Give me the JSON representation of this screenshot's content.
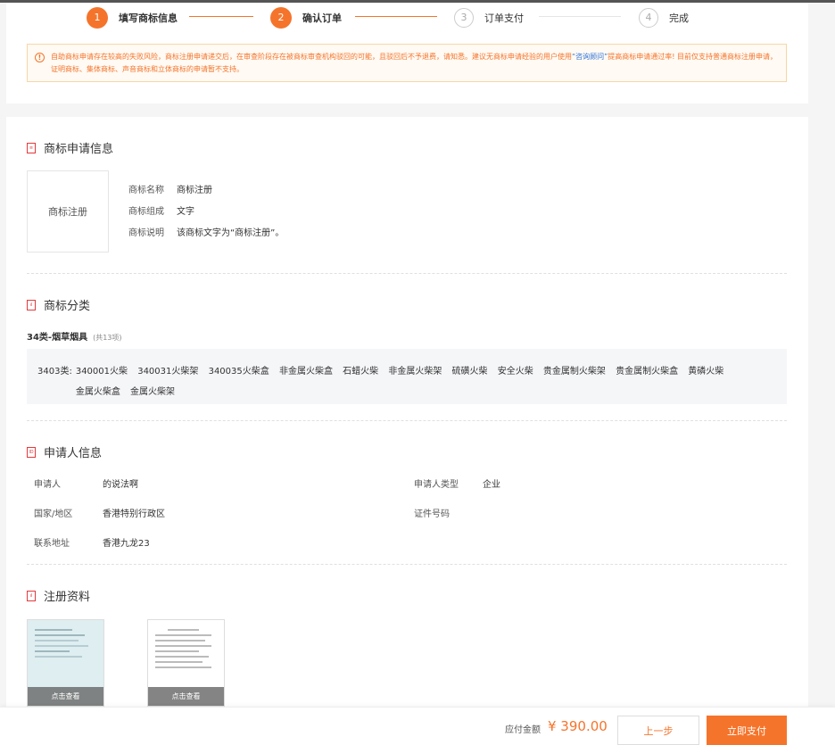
{
  "steps": [
    {
      "num": "1",
      "label": "填写商标信息"
    },
    {
      "num": "2",
      "label": "确认订单"
    },
    {
      "num": "3",
      "label": "订单支付"
    },
    {
      "num": "4",
      "label": "完成"
    }
  ],
  "notice": {
    "icon": "!",
    "text_before": "自助商标申请存在较高的失败风险，商标注册申请递交后，在审查阶段存在被商标审查机构驳回的可能，且驳回后不予退费，请知悉。建议无商标申请经验的用户使用",
    "link": "“咨询顾问”",
    "text_after": "提高商标申请通过率! 目前仅支持普通商标注册申请，证明商标、集体商标、声音商标和立体商标的申请暂不支持。"
  },
  "trademark_section": {
    "title": "商标申请信息",
    "preview_text": "商标注册",
    "rows": [
      {
        "key": "商标名称",
        "value": "商标注册"
      },
      {
        "key": "商标组成",
        "value": "文字"
      },
      {
        "key": "商标说明",
        "value": "该商标文字为“商标注册”。"
      }
    ]
  },
  "class_section": {
    "title": "商标分类",
    "class_name": "34类-烟草烟具",
    "count": "(共13项)",
    "group_code": "3403类:",
    "items": [
      "340001火柴",
      "340031火柴架",
      "340035火柴盒",
      "非金属火柴盒",
      "石蜡火柴",
      "非金属火柴架",
      "硫磺火柴",
      "安全火柴",
      "贵金属制火柴架",
      "贵金属制火柴盒",
      "黄磷火柴",
      "金属火柴盒",
      "金属火柴架"
    ]
  },
  "applicant_section": {
    "title": "申请人信息",
    "applicant_label": "申请人",
    "applicant_value": "的说法啊",
    "type_label": "申请人类型",
    "type_value": "企业",
    "region_label": "国家/地区",
    "region_value": "香港特别行政区",
    "cert_label": "证件号码",
    "cert_value": "",
    "address_label": "联系地址",
    "address_value": "香港九龙23"
  },
  "docs_section": {
    "title": "注册资料",
    "thumb_caption_1": "点击查看",
    "thumb_caption_2": "点击查看"
  },
  "footer": {
    "amount_label": "应付金额",
    "amount": "¥ 390.00",
    "prev_label": "上一步",
    "pay_label": "立即支付"
  },
  "colors": {
    "accent": "#f5742b",
    "link": "#2e73d9",
    "section_icon": "#e4393c"
  }
}
